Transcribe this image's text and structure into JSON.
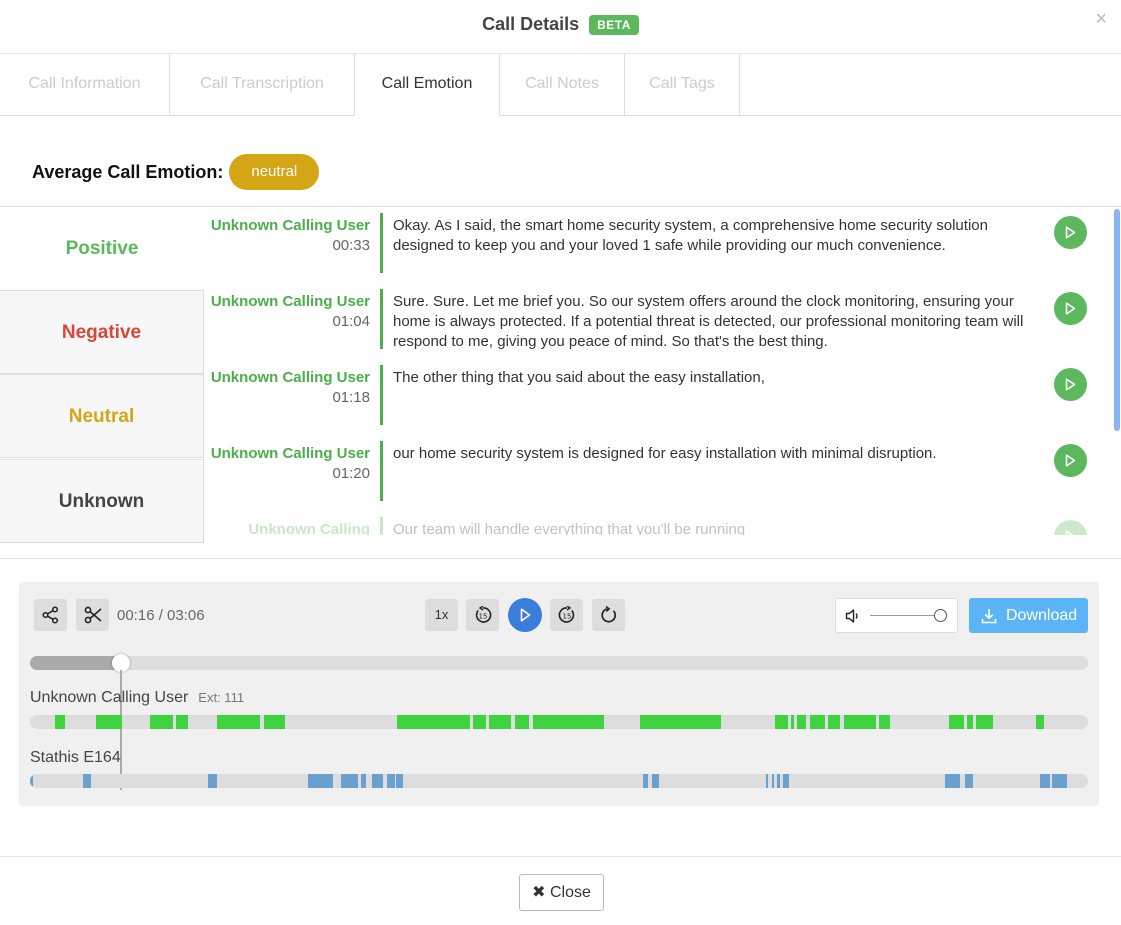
{
  "header": {
    "title": "Call Details",
    "badge": "BETA",
    "close_glyph": "×"
  },
  "tabs": [
    {
      "label": "Call Information",
      "active": false
    },
    {
      "label": "Call Transcription",
      "active": false
    },
    {
      "label": "Call Emotion",
      "active": true
    },
    {
      "label": "Call Notes",
      "active": false
    },
    {
      "label": "Call Tags",
      "active": false
    }
  ],
  "average": {
    "label": "Average Call Emotion:",
    "value": "neutral",
    "color": "#d4a514"
  },
  "emotions": [
    {
      "label": "Positive",
      "color": "#5cb85c",
      "selected": true
    },
    {
      "label": "Negative",
      "color": "#d9463a",
      "selected": false
    },
    {
      "label": "Neutral",
      "color": "#d4a514",
      "selected": false
    },
    {
      "label": "Unknown",
      "color": "#444444",
      "selected": false
    }
  ],
  "transcript": [
    {
      "speaker": "Unknown Calling User",
      "time": "00:33",
      "text": "Okay. As I said, the smart home security system, a comprehensive home security solution designed to keep you and your loved 1 safe while providing our much convenience."
    },
    {
      "speaker": "Unknown Calling User",
      "time": "01:04",
      "text": "Sure. Sure. Let me brief you. So our system offers around the clock monitoring, ensuring your home is always protected. If a potential threat is detected, our professional monitoring team will respond to me, giving you peace of mind. So that's the best thing."
    },
    {
      "speaker": "Unknown Calling User",
      "time": "01:18",
      "text": "The other thing that you said about the easy installation,"
    },
    {
      "speaker": "Unknown Calling User",
      "time": "01:20",
      "text": "our home security system is designed for easy installation with minimal disruption."
    },
    {
      "speaker": "Unknown Calling",
      "time": "",
      "text": "Our team will handle everything that you'll be running"
    }
  ],
  "player": {
    "time": "00:16 / 03:06",
    "rate": "1x",
    "download": "Download",
    "progress": 0.086,
    "volume": 1.0,
    "icons": [
      "share-icon",
      "scissors-icon",
      "rewind-15-icon",
      "play-icon",
      "forward-15-icon",
      "reload-icon",
      "volume-icon",
      "download-icon"
    ]
  },
  "tracks": [
    {
      "name": "Unknown Calling User",
      "ext": "Ext: 111",
      "color": "#3fd43f",
      "segments": [
        [
          0.024,
          0.033
        ],
        [
          0.062,
          0.087
        ],
        [
          0.113,
          0.135
        ],
        [
          0.138,
          0.149
        ],
        [
          0.177,
          0.217
        ],
        [
          0.221,
          0.241
        ],
        [
          0.347,
          0.416
        ],
        [
          0.419,
          0.431
        ],
        [
          0.434,
          0.455
        ],
        [
          0.458,
          0.472
        ],
        [
          0.475,
          0.543
        ],
        [
          0.577,
          0.653
        ],
        [
          0.704,
          0.716
        ],
        [
          0.719,
          0.722
        ],
        [
          0.725,
          0.733
        ],
        [
          0.737,
          0.751
        ],
        [
          0.754,
          0.766
        ],
        [
          0.769,
          0.8
        ],
        [
          0.802,
          0.813
        ],
        [
          0.869,
          0.883
        ],
        [
          0.886,
          0.891
        ],
        [
          0.894,
          0.91
        ],
        [
          0.951,
          0.958
        ]
      ]
    },
    {
      "name": "Stathis E164",
      "ext": "",
      "color": "#6aa0d0",
      "segments": [
        [
          0.0,
          0.003
        ],
        [
          0.05,
          0.058
        ],
        [
          0.168,
          0.177
        ],
        [
          0.263,
          0.286
        ],
        [
          0.294,
          0.31
        ],
        [
          0.313,
          0.318
        ],
        [
          0.323,
          0.334
        ],
        [
          0.337,
          0.345
        ],
        [
          0.346,
          0.353
        ],
        [
          0.579,
          0.584
        ],
        [
          0.588,
          0.595
        ],
        [
          0.696,
          0.698
        ],
        [
          0.701,
          0.703
        ],
        [
          0.706,
          0.709
        ],
        [
          0.712,
          0.717
        ],
        [
          0.865,
          0.879
        ],
        [
          0.884,
          0.891
        ],
        [
          0.955,
          0.964
        ],
        [
          0.966,
          0.98
        ]
      ]
    }
  ],
  "footer": {
    "close_label": "Close",
    "close_glyph": "✖"
  }
}
